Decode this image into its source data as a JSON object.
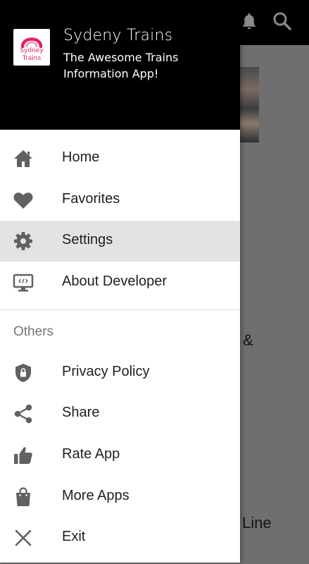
{
  "background": {
    "toolbar_icons": [
      "bell-icon",
      "search-icon"
    ],
    "partial_text": {
      "ampersand": "&",
      "line": "Line"
    }
  },
  "drawer": {
    "header": {
      "logo_text_line1": "Sydney",
      "logo_text_line2": "Trains",
      "title": "Sydeny Trains",
      "subtitle": "The Awesome Trains Information App!"
    },
    "main_items": [
      {
        "label": "Home",
        "icon": "home-icon",
        "selected": false
      },
      {
        "label": "Favorites",
        "icon": "heart-icon",
        "selected": false
      },
      {
        "label": "Settings",
        "icon": "gear-icon",
        "selected": true
      },
      {
        "label": "About Developer",
        "icon": "monitor-code-icon",
        "selected": false
      }
    ],
    "section_title": "Others",
    "other_items": [
      {
        "label": "Privacy Policy",
        "icon": "shield-lock-icon"
      },
      {
        "label": "Share",
        "icon": "share-icon"
      },
      {
        "label": "Rate App",
        "icon": "thumbs-up-icon"
      },
      {
        "label": "More Apps",
        "icon": "shopping-bag-icon"
      },
      {
        "label": "Exit",
        "icon": "close-icon"
      }
    ]
  },
  "colors": {
    "header_bg": "#000000",
    "drawer_bg": "#ffffff",
    "selected_bg": "#e3e3e3",
    "icon_color": "#616161",
    "logo_accent": "#d81b60"
  }
}
